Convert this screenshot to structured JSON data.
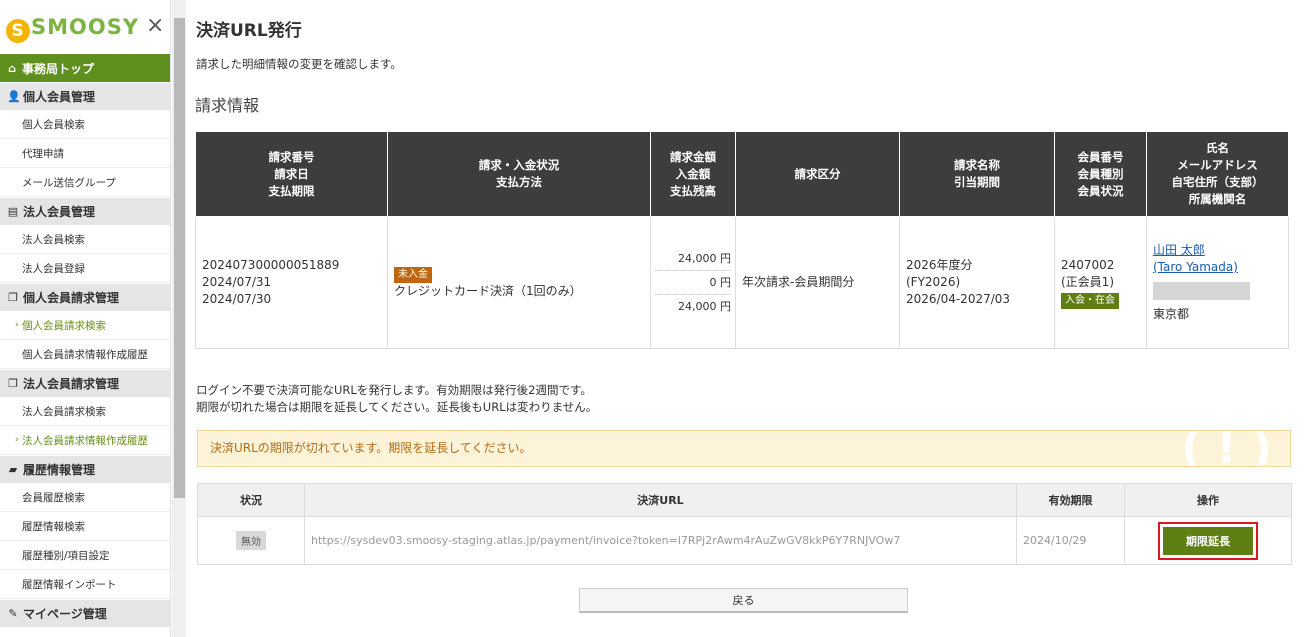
{
  "sidebar": {
    "logo": "SMOOSY",
    "close_label": "×",
    "top_item": "事務局トップ",
    "sections": [
      {
        "icon": "person-icon",
        "label": "個人会員管理",
        "items": [
          {
            "label": "個人会員検索",
            "active": false
          },
          {
            "label": "代理申請",
            "active": false
          },
          {
            "label": "メール送信グループ",
            "active": false
          }
        ]
      },
      {
        "icon": "building-icon",
        "label": "法人会員管理",
        "items": [
          {
            "label": "法人会員検索",
            "active": false
          },
          {
            "label": "法人会員登録",
            "active": false
          }
        ]
      },
      {
        "icon": "copy-icon",
        "label": "個人会員請求管理",
        "items": [
          {
            "label": "個人会員請求検索",
            "active": true
          },
          {
            "label": "個人会員請求情報作成履歴",
            "active": false
          }
        ]
      },
      {
        "icon": "copy-icon",
        "label": "法人会員請求管理",
        "items": [
          {
            "label": "法人会員請求検索",
            "active": false
          },
          {
            "label": "法人会員請求情報作成履歴",
            "active": true
          }
        ]
      },
      {
        "icon": "folder-icon",
        "label": "履歴情報管理",
        "items": [
          {
            "label": "会員履歴検索",
            "active": false
          },
          {
            "label": "履歴情報検索",
            "active": false
          },
          {
            "label": "履歴種別/項目設定",
            "active": false
          },
          {
            "label": "履歴情報インポート",
            "active": false
          }
        ]
      },
      {
        "icon": "pin-icon",
        "label": "マイページ管理",
        "items": []
      }
    ]
  },
  "page": {
    "title": "決済URL発行",
    "subtitle": "請求した明細情報の変更を確認します。",
    "section_title": "請求情報"
  },
  "invoice": {
    "headers": [
      [
        "請求番号",
        "請求日",
        "支払期限"
      ],
      [
        "請求・入金状況",
        "支払方法"
      ],
      [
        "請求金額",
        "入金額",
        "支払残高"
      ],
      [
        "請求区分"
      ],
      [
        "請求名称",
        "引当期間"
      ],
      [
        "会員番号",
        "会員種別",
        "会員状況"
      ],
      [
        "氏名",
        "メールアドレス",
        "自宅住所（支部）",
        "所属機関名"
      ]
    ],
    "row": {
      "invoice_no": "202407300000051889",
      "invoice_date": "2024/07/31",
      "due_date": "2024/07/30",
      "status_tag": "未入金",
      "payment_method": "クレジットカード決済（1回のみ）",
      "amount_billed": "24,000 円",
      "amount_paid": "0 円",
      "amount_remaining": "24,000 円",
      "category": "年次請求-会員期間分",
      "name_title": "2026年度分",
      "name_fy": "(FY2026)",
      "period": "2026/04-2027/03",
      "member_no": "2407002",
      "member_type": "(正会員1)",
      "member_status": "入会・在会",
      "name": "山田 太郎",
      "name_en": "(Taro Yamada)",
      "address": "東京都"
    }
  },
  "note": {
    "line1": "ログイン不要で決済可能なURLを発行します。有効期限は発行後2週間です。",
    "line2": "期限が切れた場合は期限を延長してください。延長後もURLは変わりません。"
  },
  "alert": {
    "message": "決済URLの期限が切れています。期限を延長してください。",
    "icon_glyph": "( ! )"
  },
  "url_table": {
    "headers": [
      "状況",
      "決済URL",
      "有効期限",
      "操作"
    ],
    "row": {
      "status": "無効",
      "url": "https://sysdev03.smoosy-staging.atlas.jp/payment/invoice?token=l7RPj2rAwm4rAuZwGV8kkP6Y7RNJVOw7",
      "expiry": "2024/10/29",
      "action": "期限延長"
    }
  },
  "back_label": "戻る",
  "colors": {
    "brand_green": "#5f8f1f",
    "header_dark": "#3d3d3d",
    "alert_bg": "#fdf3d8",
    "highlight_red": "#e0161e"
  }
}
